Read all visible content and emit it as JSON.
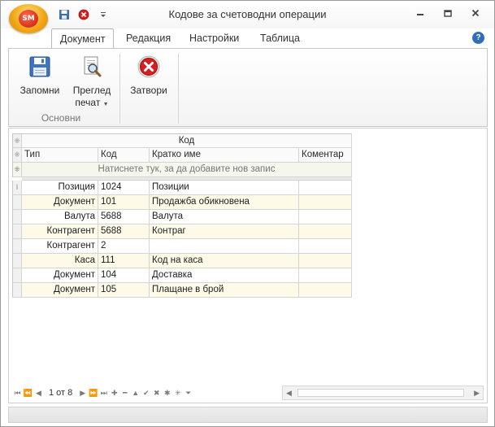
{
  "window": {
    "title": "Кодове за счетоводни операции",
    "logo_text": "SM"
  },
  "tabs": [
    {
      "label": "Документ",
      "active": true
    },
    {
      "label": "Редакция",
      "active": false
    },
    {
      "label": "Настройки",
      "active": false
    },
    {
      "label": "Таблица",
      "active": false
    }
  ],
  "ribbon": {
    "save_label": "Запомни",
    "preview_label_1": "Преглед",
    "preview_label_2": "печат",
    "close_label": "Затвори",
    "group_label": "Основни"
  },
  "grid": {
    "band_header": "Код",
    "columns": [
      "Тип",
      "Код",
      "Кратко име",
      "Коментар"
    ],
    "new_row_text": "Натиснете тук, за да добавите нов запис",
    "rows": [
      {
        "type": "Позиция",
        "code": "1024",
        "name": "Позиции",
        "comment": ""
      },
      {
        "type": "Документ",
        "code": "101",
        "name": "Продажба обикновена",
        "comment": ""
      },
      {
        "type": "Валута",
        "code": "5688",
        "name": "Валута",
        "comment": ""
      },
      {
        "type": "Контрагент",
        "code": "5688",
        "name": "Контраг",
        "comment": ""
      },
      {
        "type": "Контрагент",
        "code": "2",
        "name": "",
        "comment": ""
      },
      {
        "type": "Каса",
        "code": "111",
        "name": "Код на каса",
        "comment": ""
      },
      {
        "type": "Документ",
        "code": "104",
        "name": "Доставка",
        "comment": ""
      },
      {
        "type": "Документ",
        "code": "105",
        "name": "Плащане в брой",
        "comment": ""
      }
    ]
  },
  "navigator": {
    "record_text": "1 от 8"
  },
  "colors": {
    "accent": "#2f6dbf",
    "close_red": "#d42020",
    "row_alt": "#fdfbe8"
  }
}
